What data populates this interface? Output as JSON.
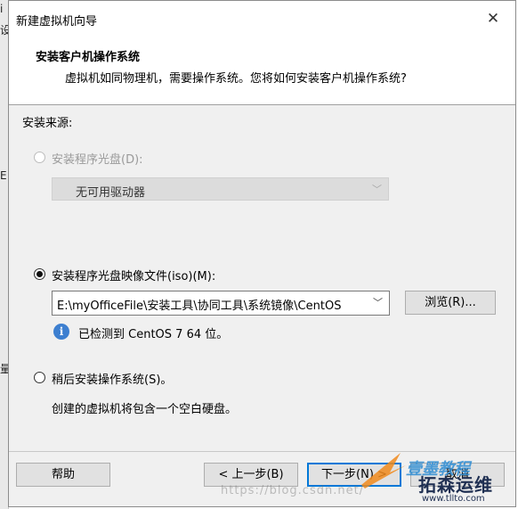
{
  "window": {
    "title": "新建虚拟机向导",
    "close_glyph": "✕"
  },
  "header": {
    "heading": "安装客户机操作系统",
    "subheading": "虚拟机如同物理机，需要操作系统。您将如何安装客户机操作系统?"
  },
  "install_source": {
    "label": "安装来源:",
    "disc_option": {
      "label": "安装程序光盘(D):",
      "selected": false,
      "enabled": false
    },
    "disc_drive_select": {
      "value": "无可用驱动器",
      "enabled": false
    },
    "iso_option": {
      "label": "安装程序光盘映像文件(iso)(M):",
      "selected": true
    },
    "iso_path": {
      "value": "E:\\myOfficeFile\\安装工具\\协同工具\\系统镜像\\CentOS"
    },
    "browse_label": "浏览(R)...",
    "detected_icon": "info-icon",
    "detected_text": "已检测到 CentOS 7 64 位。",
    "later_option": {
      "label": "稍后安装操作系统(S)。",
      "selected": false
    },
    "later_description": "创建的虚拟机将包含一个空白硬盘。"
  },
  "footer": {
    "help_label": "帮助",
    "back_label": "< 上一步(B)",
    "next_label": "下一步(N) >",
    "cancel_label": "取消"
  },
  "background_window": {
    "glyphs": [
      "i",
      "设",
      "E",
      "量"
    ]
  },
  "watermark": {
    "url": "https://blog.csdn.net/",
    "brand": "拓森运维",
    "brand_site": "www.tllto.com",
    "brand_overlay": "壹墨教程"
  },
  "colors": {
    "accent": "#0078d7",
    "info_icon": "#3d7fd0",
    "watermark_orange": "#f08a1c"
  }
}
